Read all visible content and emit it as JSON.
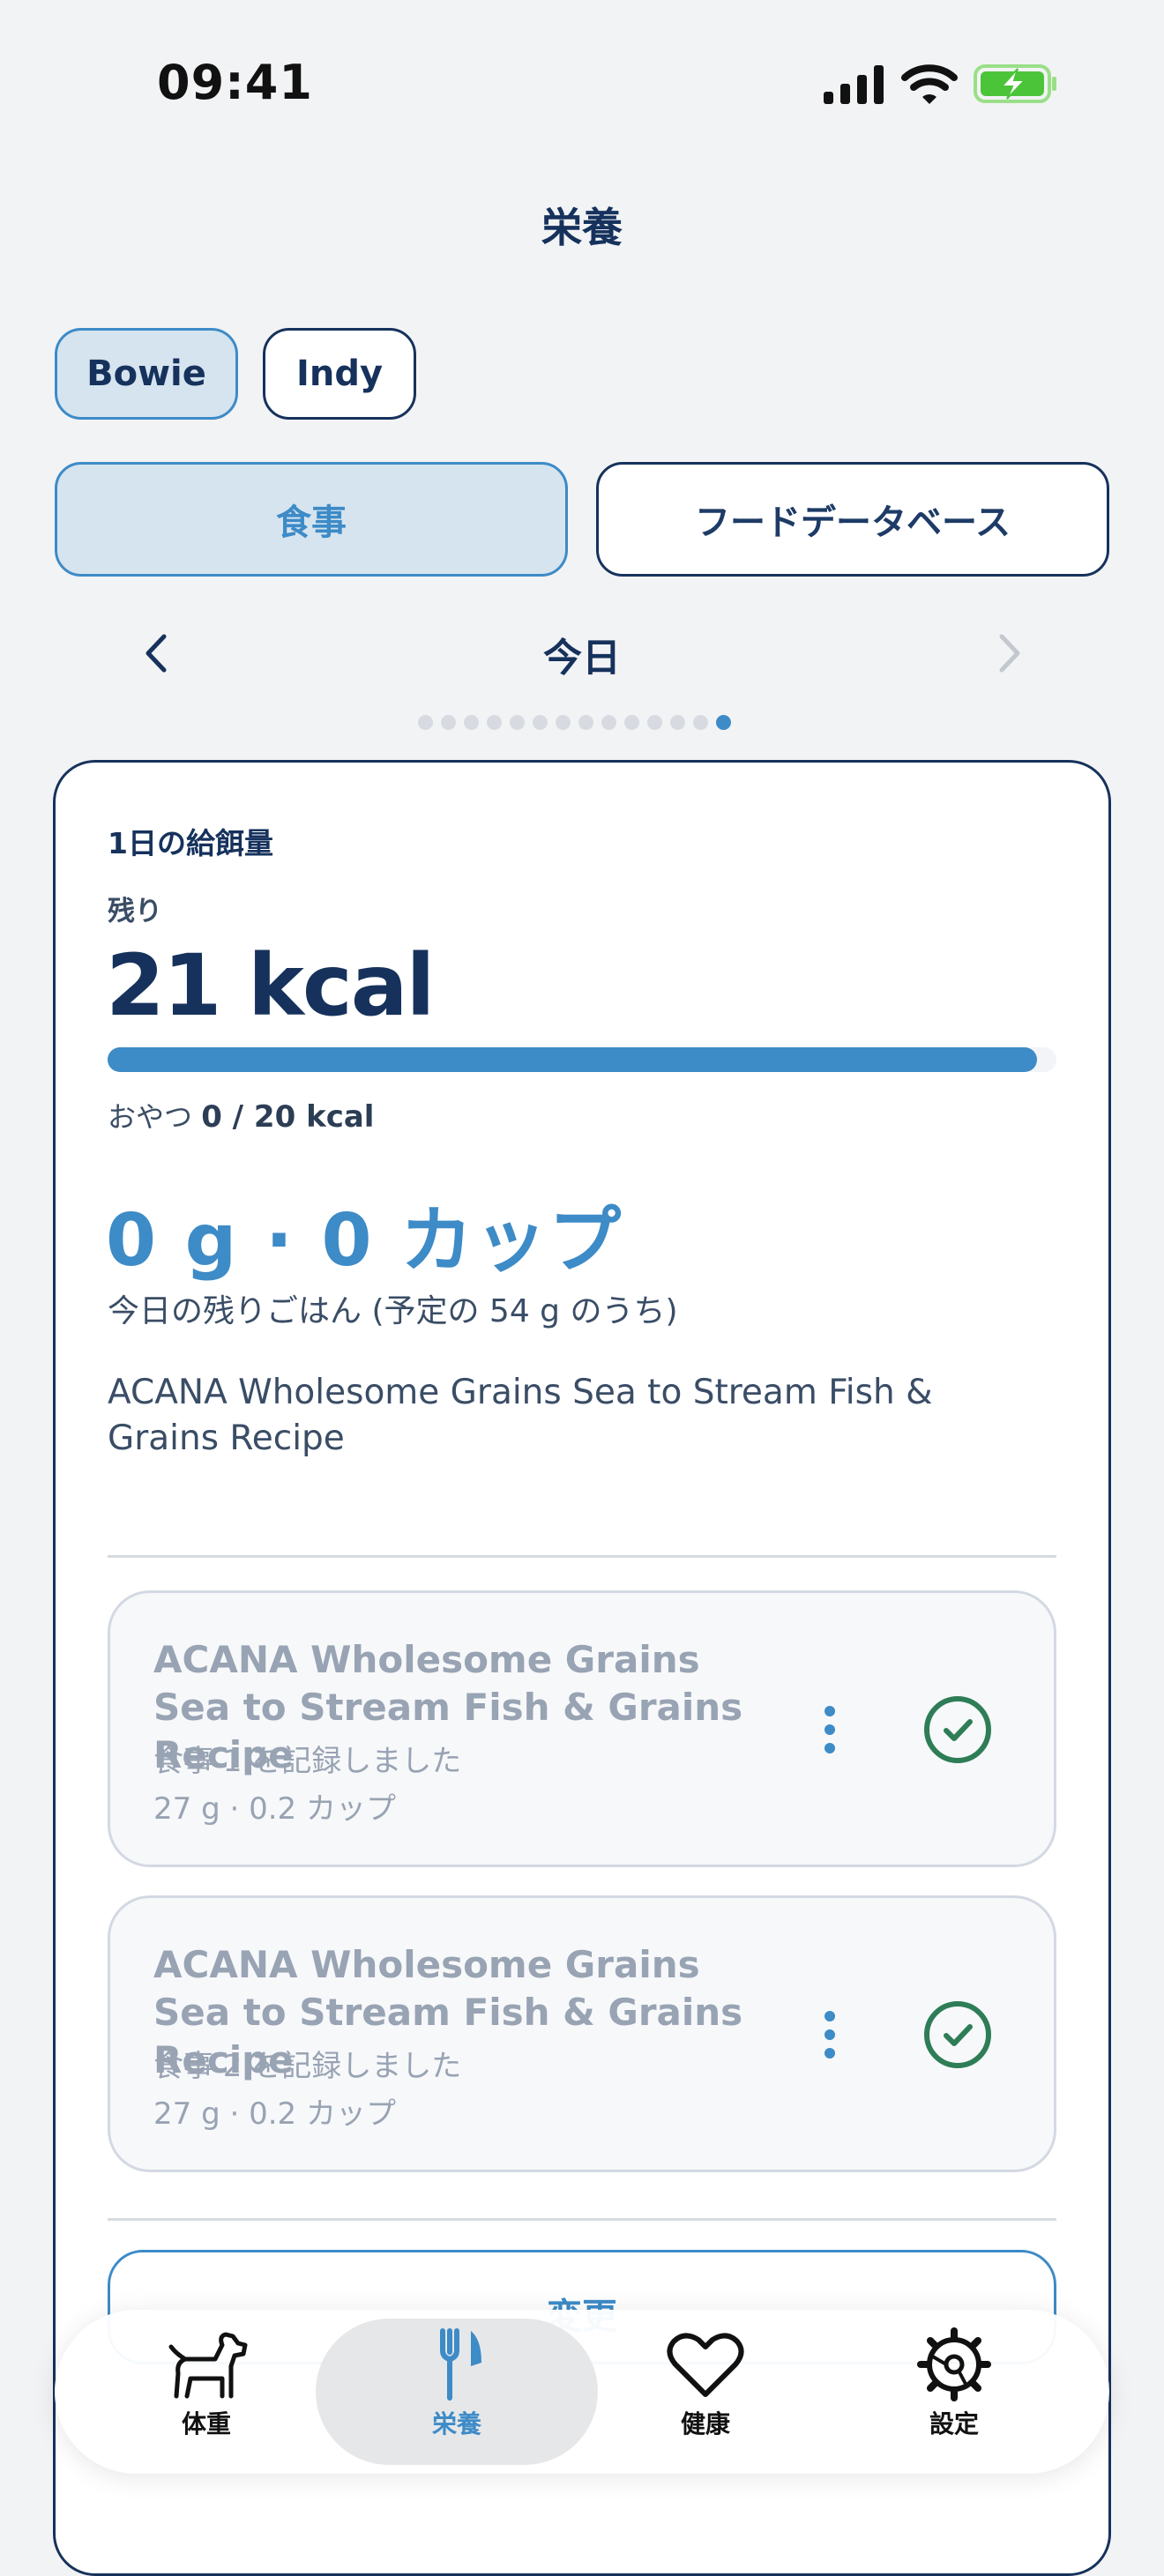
{
  "status_bar": {
    "time": "09:41"
  },
  "header": {
    "title": "栄養"
  },
  "pets": [
    {
      "name": "Bowie",
      "active": true
    },
    {
      "name": "Indy",
      "active": false
    }
  ],
  "segments": [
    {
      "label": "食事",
      "active": true
    },
    {
      "label": "フードデータベース",
      "active": false
    }
  ],
  "date_nav": {
    "label": "今日",
    "page_count": 14,
    "current_page": 14
  },
  "daily": {
    "section_title": "1日の給餌量",
    "remaining_label": "残り",
    "remaining_kcal": "21 kcal",
    "progress_fraction": 0.98,
    "treat_label": "おやつ",
    "treat_value": "0 / 20 kcal",
    "portion": "0 g · 0 カップ",
    "portion_sub": "今日の残りごはん (予定の 54 g のうち)",
    "food_name": "ACANA Wholesome Grains Sea to Stream Fish & Grains Recipe"
  },
  "meals": [
    {
      "name": "ACANA Wholesome Grains Sea to Stream Fish & Grains Recipe",
      "status": "食事 1 を記録しました",
      "amount": "27 g · 0.2 カップ",
      "done": true
    },
    {
      "name": "ACANA Wholesome Grains Sea to Stream Fish & Grains Recipe",
      "status": "食事 2 を記録しました",
      "amount": "27 g · 0.2 カップ",
      "done": true
    }
  ],
  "edit_button": {
    "label": "変更"
  },
  "tabbar": [
    {
      "label": "体重",
      "icon": "dog-icon",
      "active": false
    },
    {
      "label": "栄養",
      "icon": "fork-knife-icon",
      "active": true
    },
    {
      "label": "健康",
      "icon": "heart-icon",
      "active": false
    },
    {
      "label": "設定",
      "icon": "gear-icon",
      "active": false
    }
  ],
  "colors": {
    "accent": "#3d8bc7",
    "navy": "#16325c",
    "success": "#2e7d57"
  }
}
